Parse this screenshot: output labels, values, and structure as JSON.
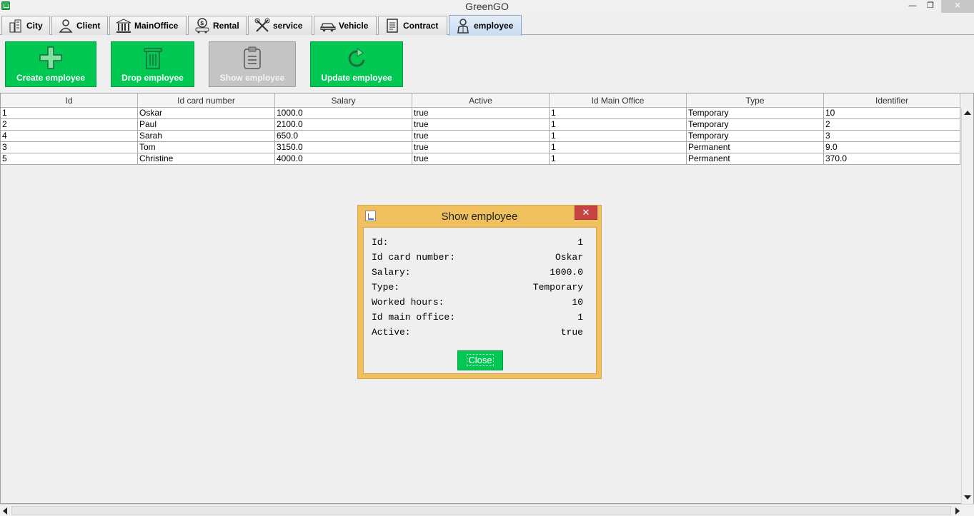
{
  "window": {
    "title": "GreenGO"
  },
  "tabs": [
    {
      "label": "City",
      "icon": "city-icon"
    },
    {
      "label": "Client",
      "icon": "person-icon"
    },
    {
      "label": "MainOffice",
      "icon": "bank-icon"
    },
    {
      "label": "Rental",
      "icon": "money-car-icon"
    },
    {
      "label": "service",
      "icon": "tools-icon"
    },
    {
      "label": "Vehicle",
      "icon": "car-icon"
    },
    {
      "label": "Contract",
      "icon": "contract-icon"
    },
    {
      "label": "employee",
      "icon": "employee-icon",
      "active": true
    }
  ],
  "actions": {
    "create": "Create employee",
    "drop": "Drop employee",
    "show": "Show employee",
    "update": "Update employee"
  },
  "table": {
    "columns": [
      "Id",
      "Id card number",
      "Salary",
      "Active",
      "Id Main Office",
      "Type",
      "Identifier"
    ],
    "rows": [
      [
        "1",
        "Oskar",
        "1000.0",
        "true",
        "1",
        "Temporary",
        "10"
      ],
      [
        "2",
        "Paul",
        "2100.0",
        "true",
        "1",
        "Temporary",
        "2"
      ],
      [
        "4",
        "Sarah",
        "650.0",
        "true",
        "1",
        "Temporary",
        "3"
      ],
      [
        "3",
        "Tom",
        "3150.0",
        "true",
        "1",
        "Permanent",
        "9.0"
      ],
      [
        "5",
        "Christine",
        "4000.0",
        "true",
        "1",
        "Permanent",
        "370.0"
      ]
    ]
  },
  "dialog": {
    "title": "Show employee",
    "fields": [
      {
        "label": "Id:",
        "value": "1"
      },
      {
        "label": "Id card number:",
        "value": "Oskar"
      },
      {
        "label": "Salary:",
        "value": "1000.0"
      },
      {
        "label": "Type:",
        "value": "Temporary"
      },
      {
        "label": "Worked hours:",
        "value": "10"
      },
      {
        "label": "Id main office:",
        "value": "1"
      },
      {
        "label": "Active:",
        "value": "true"
      }
    ],
    "close_label": "Close"
  },
  "colors": {
    "accent_green": "#00c853",
    "dialog_frame": "#f0c05e",
    "close_red": "#c74443",
    "active_tab": "#c9dcf2"
  }
}
